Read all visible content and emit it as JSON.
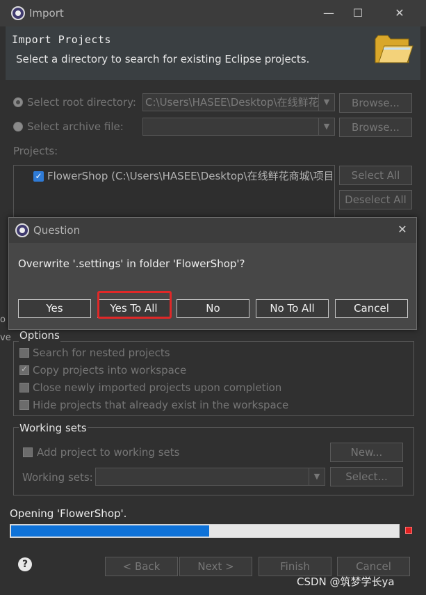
{
  "window": {
    "title": "Import",
    "minimize_glyph": "—",
    "maximize_glyph": "☐",
    "close_glyph": "✕"
  },
  "header": {
    "title": "Import Projects",
    "description": "Select a directory to search for existing Eclipse projects."
  },
  "source": {
    "root_dir_label": "Select root directory:",
    "root_dir_value": "C:\\Users\\HASEE\\Desktop\\在线鲜花",
    "archive_label": "Select archive file:",
    "archive_value": "",
    "browse_label": "Browse..."
  },
  "projects": {
    "label": "Projects:",
    "items": [
      {
        "label": "FlowerShop (C:\\Users\\HASEE\\Desktop\\在线鲜花商城\\项目源",
        "checked": true
      }
    ],
    "select_all": "Select All",
    "deselect_all": "Deselect All"
  },
  "options": {
    "title": "Options",
    "items": [
      {
        "label": "Search for nested projects",
        "checked": false
      },
      {
        "label": "Copy projects into workspace",
        "checked": true
      },
      {
        "label": "Close newly imported projects upon completion",
        "checked": false
      },
      {
        "label": "Hide projects that already exist in the workspace",
        "checked": false
      }
    ]
  },
  "working_sets": {
    "title": "Working sets",
    "add_label": "Add project to working sets",
    "new_button": "New...",
    "sets_label": "Working sets:",
    "sets_value": "",
    "select_button": "Select..."
  },
  "status": {
    "text": "Opening 'FlowerShop'.",
    "progress": 0.51
  },
  "footer": {
    "back": "< Back",
    "next": "Next >",
    "finish": "Finish",
    "cancel": "Cancel",
    "help_glyph": "?"
  },
  "watermark": "CSDN @筑梦学长ya",
  "dialog": {
    "title": "Question",
    "close_glyph": "✕",
    "message": "Overwrite '.settings' in folder 'FlowerShop'?",
    "buttons": [
      "Yes",
      "Yes To All",
      "No",
      "No To All",
      "Cancel"
    ],
    "highlighted_button": "Yes To All"
  },
  "side_fragments": [
    "o",
    "ve"
  ],
  "colors": {
    "progress": "#0e72d8",
    "highlight": "#e02828",
    "checkbox": "#2f7bd6",
    "stop": "#e02020"
  }
}
